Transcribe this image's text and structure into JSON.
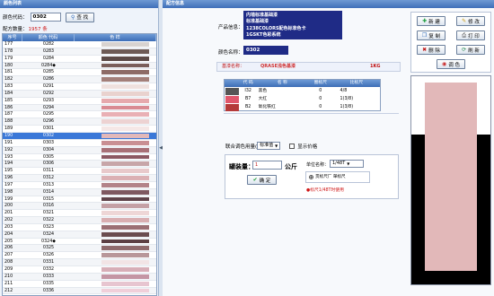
{
  "left_panel": {
    "title": "颜色列表",
    "code_label": "颜色代码：",
    "code_value": "0302",
    "query_label": "查 找",
    "count_label": "配方数量：",
    "count_value": "1957 条",
    "columns": [
      "序号",
      "颜色 代码",
      "色 样"
    ],
    "rows": [
      {
        "no": "177",
        "code": "0282",
        "color": "#d8d3d0"
      },
      {
        "no": "178",
        "code": "0283",
        "color": "#6d5a55"
      },
      {
        "no": "179",
        "code": "0284",
        "color": "#5c4a47"
      },
      {
        "no": "180",
        "code": "0284◆",
        "color": "#7a5e5a"
      },
      {
        "no": "181",
        "code": "0285",
        "color": "#8d6b66"
      },
      {
        "no": "182",
        "code": "0286",
        "color": "#a37f79"
      },
      {
        "no": "183",
        "code": "0291",
        "color": "#efe1de"
      },
      {
        "no": "184",
        "code": "0292",
        "color": "#e9d2ce"
      },
      {
        "no": "185",
        "code": "0293",
        "color": "#e6a9ad"
      },
      {
        "no": "186",
        "code": "0294",
        "color": "#d98a92"
      },
      {
        "no": "187",
        "code": "0295",
        "color": "#e9b0b5"
      },
      {
        "no": "188",
        "code": "0296",
        "color": "#edd2d2"
      },
      {
        "no": "189",
        "code": "0301",
        "color": "#f5e7e6"
      },
      {
        "no": "190",
        "code": "0302",
        "color": "#e2b8b9"
      },
      {
        "no": "191",
        "code": "0303",
        "color": "#c98f93"
      },
      {
        "no": "192",
        "code": "0304",
        "color": "#a87077"
      },
      {
        "no": "193",
        "code": "0305",
        "color": "#8c5963"
      },
      {
        "no": "194",
        "code": "0306",
        "color": "#c7a5a8"
      },
      {
        "no": "195",
        "code": "0311",
        "color": "#e8c9cb"
      },
      {
        "no": "196",
        "code": "0312",
        "color": "#dbb0b4"
      },
      {
        "no": "197",
        "code": "0313",
        "color": "#b38389"
      },
      {
        "no": "198",
        "code": "0314",
        "color": "#7e5860"
      },
      {
        "no": "199",
        "code": "0315",
        "color": "#5f434a"
      },
      {
        "no": "200",
        "code": "0316",
        "color": "#c4a0a5"
      },
      {
        "no": "201",
        "code": "0321",
        "color": "#eed6d6"
      },
      {
        "no": "202",
        "code": "0322",
        "color": "#d9aeb1"
      },
      {
        "no": "203",
        "code": "0323",
        "color": "#9b6f74"
      },
      {
        "no": "204",
        "code": "0324",
        "color": "#6a4c4f"
      },
      {
        "no": "205",
        "code": "0324◆",
        "color": "#5c3f43"
      },
      {
        "no": "206",
        "code": "0325",
        "color": "#8f6a6c"
      },
      {
        "no": "207",
        "code": "0326",
        "color": "#b8979a"
      },
      {
        "no": "208",
        "code": "0331",
        "color": "#f2e4e5"
      },
      {
        "no": "209",
        "code": "0332",
        "color": "#d7aeb7"
      },
      {
        "no": "210",
        "code": "0333",
        "color": "#c496a4"
      },
      {
        "no": "211",
        "code": "0335",
        "color": "#e7c5d0"
      },
      {
        "no": "212",
        "code": "0336",
        "color": "#f0cfd9"
      }
    ],
    "selected_index": 13
  },
  "right_panel": {
    "title": "配方信息",
    "product_label": "产品信息：",
    "product_lines": [
      "内墙标准基础漆",
      "标准基础漆",
      "1238COLORS配色标准色卡",
      "1GSKT色彩系统"
    ],
    "color_name_label": "颜色名称：",
    "color_name_value": "0302",
    "base_label": "基漆名称：",
    "base_value": "QRASE浅色基漆",
    "base_size": "1KG",
    "formula_columns": [
      "代 码",
      "名  称",
      "圈标尺",
      "比标尺"
    ],
    "formula_rows": [
      {
        "code": "I32",
        "name": "黑色",
        "b": "0",
        "r": "4/8",
        "color": "#555555"
      },
      {
        "code": "B7",
        "name": "大红",
        "b": "0",
        "r": "1(3/8)",
        "color": "#e0566b"
      },
      {
        "code": "B2",
        "name": "氧化铁红",
        "b": "0",
        "r": "1(3/8)",
        "color": "#b53a3a"
      }
    ],
    "unit_label": "联合调色用量(",
    "unit_value": "标准值",
    "show_price_label": "显示价格",
    "fill_label": "罐装量：",
    "fill_value": "1",
    "fill_unit": "公斤",
    "ok_label": "确 定",
    "unit_name_label": "单位名称：",
    "unit_name_value": "1/48T",
    "radio_label": "贯标尺厂  單标尺",
    "hint": "●标尺1/48T时使用",
    "buttons": {
      "new": "新 建",
      "edit": "修 改",
      "copy": "复 制",
      "print": "打 印",
      "delete": "删 除",
      "refresh": "刷 新",
      "color": "调 色"
    },
    "preview_color": "#e2b8b9"
  }
}
